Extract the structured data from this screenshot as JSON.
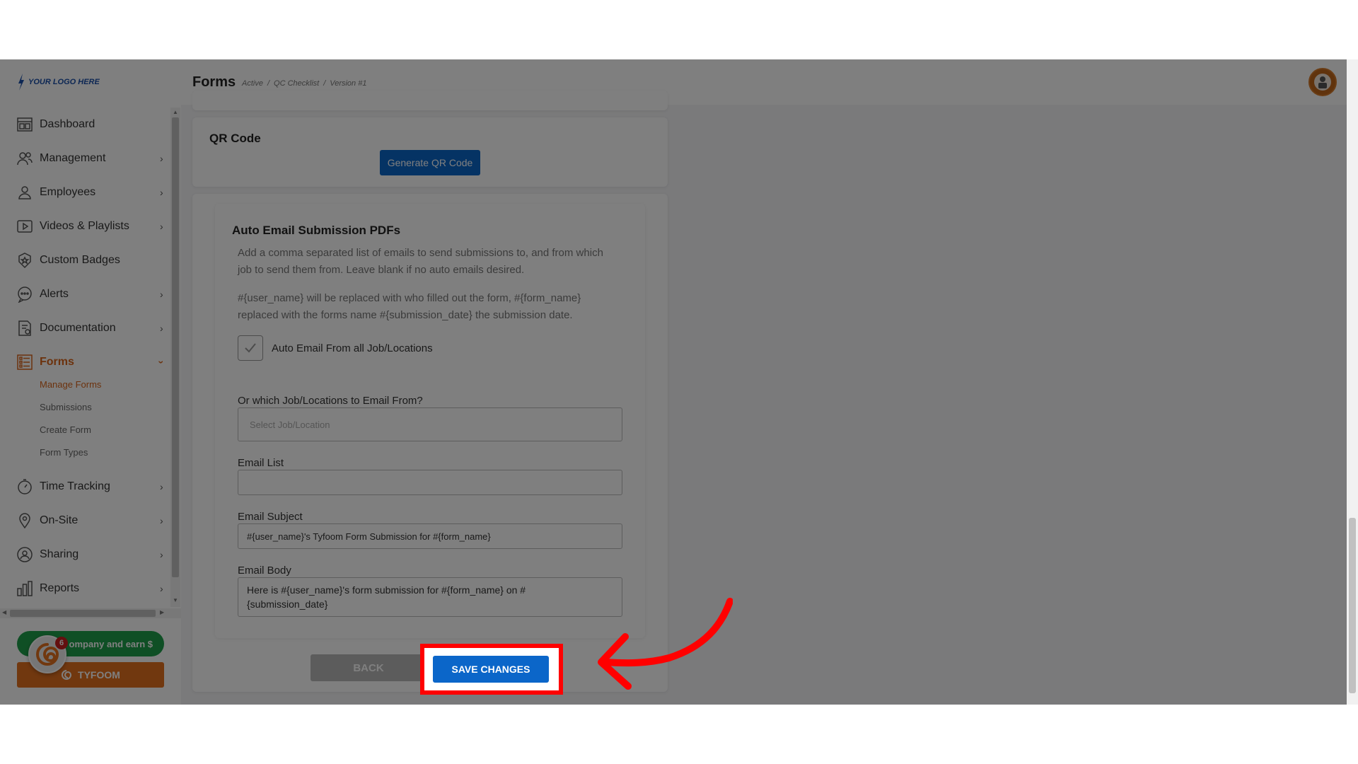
{
  "logo": {
    "text": "YOUR LOGO HERE"
  },
  "header": {
    "title": "Forms",
    "breadcrumb": [
      "Active",
      "/",
      "QC Checklist",
      "/",
      "Version #1"
    ]
  },
  "sidebar": {
    "items": [
      {
        "label": "Dashboard",
        "icon": "dashboard-icon",
        "chevron": ""
      },
      {
        "label": "Management",
        "icon": "management-icon",
        "chevron": "›"
      },
      {
        "label": "Employees",
        "icon": "person-icon",
        "chevron": "›"
      },
      {
        "label": "Videos & Playlists",
        "icon": "video-icon",
        "chevron": "›"
      },
      {
        "label": "Custom Badges",
        "icon": "badge-icon",
        "chevron": ""
      },
      {
        "label": "Alerts",
        "icon": "chat-icon",
        "chevron": "›"
      },
      {
        "label": "Documentation",
        "icon": "document-icon",
        "chevron": "›"
      },
      {
        "label": "Forms",
        "icon": "forms-icon",
        "chevron": "›"
      },
      {
        "label": "Time Tracking",
        "icon": "stopwatch-icon",
        "chevron": "›"
      },
      {
        "label": "On-Site",
        "icon": "location-pin-icon",
        "chevron": "›"
      },
      {
        "label": "Sharing",
        "icon": "share-person-icon",
        "chevron": "›"
      },
      {
        "label": "Reports",
        "icon": "bar-chart-icon",
        "chevron": "›"
      }
    ],
    "forms_subitems": [
      "Manage Forms",
      "Submissions",
      "Create Form",
      "Form Types"
    ],
    "refer_button": "Refer a company and earn $",
    "refer_visible": "ompany and earn $",
    "tyfoom_button": "TYFOOM",
    "chat_badge": "6"
  },
  "qr_card": {
    "title": "QR Code",
    "button": "Generate QR Code"
  },
  "email_card": {
    "title": "Auto Email Submission PDFs",
    "description_1_line1": "Add a comma separated list of emails to send submissions to, and from which",
    "description_1_line2": "job to send them from. Leave blank if no auto emails desired.",
    "description_2_line1": "#{user_name} will be replaced with who filled out the form, #{form_name}",
    "description_2_line2": "replaced with the forms name #{submission_date} the submission date.",
    "checkbox_label": "Auto Email From all Job/Locations",
    "checkbox_checked": true,
    "location_label": "Or which Job/Locations to Email From?",
    "location_placeholder": "Select Job/Location",
    "email_list_label": "Email List",
    "email_list_value": "",
    "subject_label": "Email Subject",
    "subject_value": "#{user_name}'s Tyfoom Form Submission for #{form_name}",
    "body_label": "Email Body",
    "body_value_line1": "Here is #{user_name}'s form submission for #{form_name} on #",
    "body_value_line2": "{submission_date}"
  },
  "actions": {
    "back": "BACK",
    "save": "SAVE CHANGES"
  },
  "colors": {
    "accent": "#d9651b",
    "primary": "#0b66c9",
    "highlight": "#ff0000"
  }
}
